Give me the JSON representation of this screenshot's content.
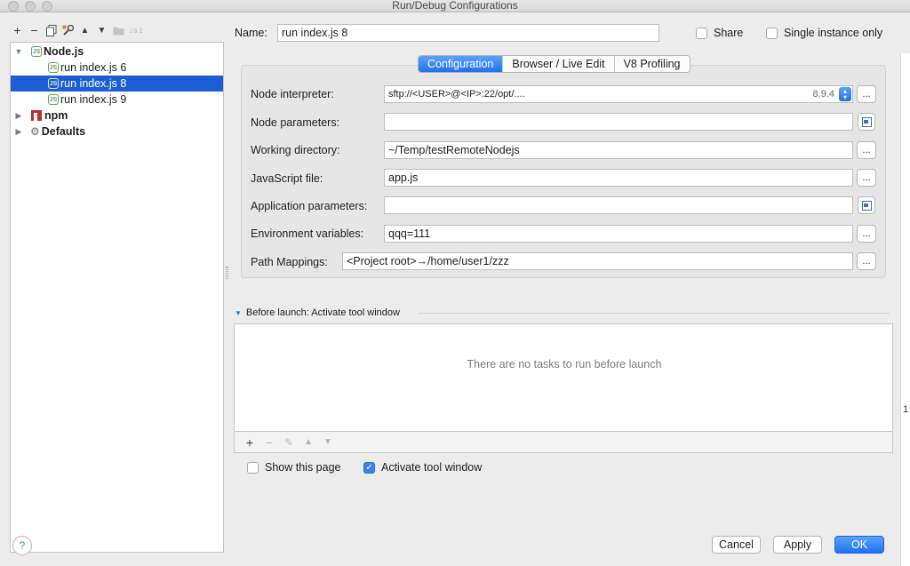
{
  "window": {
    "title": "Run/Debug Configurations"
  },
  "toolbar": {
    "icons": [
      "add-icon",
      "remove-icon",
      "copy-icon",
      "edit-defaults-icon",
      "move-up-icon",
      "move-down-icon",
      "folder-icon",
      "sort-icon"
    ],
    "add": "+",
    "remove": "−"
  },
  "tree": {
    "items": [
      {
        "label": "Node.js",
        "level": 0,
        "expanded": true
      },
      {
        "label": "run index.js 6",
        "level": 1
      },
      {
        "label": "run index.js 8",
        "level": 1,
        "selected": true
      },
      {
        "label": "run index.js 9",
        "level": 1
      },
      {
        "label": "npm",
        "level": 0,
        "expanded": false
      },
      {
        "label": "Defaults",
        "level": 0,
        "expanded": false
      }
    ]
  },
  "name": {
    "label": "Name:",
    "value": "run index.js 8"
  },
  "share": {
    "label": "Share",
    "checked": false
  },
  "single_instance": {
    "label": "Single instance only",
    "checked": false
  },
  "tabs": [
    "Configuration",
    "Browser / Live Edit",
    "V8 Profiling"
  ],
  "fields": {
    "node_interpreter": {
      "label": "Node interpreter:",
      "value": "sftp://<USER>@<IP>:22/opt/....",
      "version": "8.9.4"
    },
    "node_parameters": {
      "label": "Node parameters:",
      "value": ""
    },
    "working_directory": {
      "label": "Working directory:",
      "value": "~/Temp/testRemoteNodejs"
    },
    "javascript_file": {
      "label": "JavaScript file:",
      "value": "app.js"
    },
    "application_parameters": {
      "label": "Application parameters:",
      "value": ""
    },
    "environment_variables": {
      "label": "Environment variables:",
      "value": "qqq=111"
    },
    "path_mappings": {
      "label": "Path Mappings:",
      "value": "<Project root>→/home/user1/zzz"
    },
    "ellipsis": "..."
  },
  "before_launch": {
    "header": "Before launch: Activate tool window",
    "empty_text": "There are no tasks to run before launch",
    "add": "+",
    "remove": "−",
    "edit": "✎",
    "up": "▲",
    "down": "▼"
  },
  "show_this_page": {
    "label": "Show this page",
    "checked": false
  },
  "activate_tool_window": {
    "label": "Activate tool window",
    "checked": true
  },
  "buttons": {
    "help": "?",
    "cancel": "Cancel",
    "apply": "Apply",
    "ok": "OK"
  },
  "edge_text": "1"
}
